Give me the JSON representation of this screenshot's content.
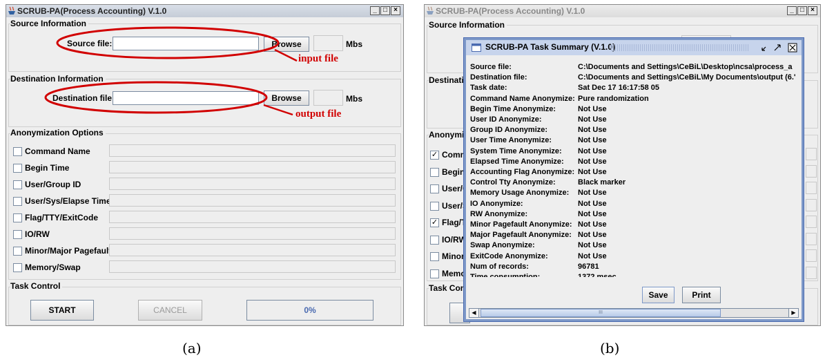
{
  "captions": {
    "a": "(a)",
    "b": "(b)"
  },
  "window_a": {
    "title": "SCRUB-PA(Process Accounting) V.1.0",
    "controls": {
      "minimize": "_",
      "maximize": "□",
      "close": "×"
    },
    "source_section": {
      "label": "Source Information",
      "field_label": "Source file:",
      "field_value": "",
      "browse_label": "Browse",
      "size_value": "",
      "unit": "Mbs"
    },
    "destination_section": {
      "label": "Destination Information",
      "field_label": "Destination file:",
      "field_value": "",
      "browse_label": "Browse",
      "size_value": "",
      "unit": "Mbs"
    },
    "anonymization_section": {
      "label": "Anonymization Options",
      "options": [
        {
          "label": "Command Name",
          "checked": false
        },
        {
          "label": "Begin Time",
          "checked": false
        },
        {
          "label": "User/Group ID",
          "checked": false
        },
        {
          "label": "User/Sys/Elapse Time",
          "checked": false
        },
        {
          "label": "Flag/TTY/ExitCode",
          "checked": false
        },
        {
          "label": "IO/RW",
          "checked": false
        },
        {
          "label": "Minor/Major Pagefault",
          "checked": false
        },
        {
          "label": "Memory/Swap",
          "checked": false
        }
      ]
    },
    "task_section": {
      "label": "Task Control",
      "start_label": "START",
      "cancel_label": "CANCEL",
      "progress_text": "0%",
      "progress_value": 0
    },
    "annotations": {
      "input": "input file",
      "output": "output file"
    },
    "annotation_color": "#d10000"
  },
  "window_b": {
    "title": "SCRUB-PA(Process Accounting) V.1.0",
    "controls": {
      "minimize": "_",
      "maximize": "□",
      "close": "×"
    },
    "section_labels": {
      "source": "Source Information",
      "destination": "Destinatio",
      "anonymization": "Anonymiz",
      "task": "Task Con"
    },
    "options": [
      {
        "label": "Comm",
        "checked": true
      },
      {
        "label": "Begin",
        "checked": false
      },
      {
        "label": "User/G",
        "checked": false
      },
      {
        "label": "User/S",
        "checked": false
      },
      {
        "label": "Flag/T",
        "checked": true
      },
      {
        "label": "IO/RW",
        "checked": false
      },
      {
        "label": "Minor/",
        "checked": false
      },
      {
        "label": "Memo",
        "checked": false
      }
    ],
    "dialog": {
      "title": "SCRUB-PA Task Summary (V.1.0)",
      "rows": [
        {
          "key": "Source file:",
          "value": "C:\\Documents and Settings\\CeBiL\\Desktop\\ncsa\\process_a"
        },
        {
          "key": "Destination file:",
          "value": "C:\\Documents and Settings\\CeBiL\\My Documents\\output (6.'"
        },
        {
          "key": "Task date:",
          "value": "Sat Dec 17  16:17:58 05"
        },
        {
          "key": "Command Name Anonymize:",
          "value": "Pure randomization"
        },
        {
          "key": "Begin Time Anonymize:",
          "value": "Not Use"
        },
        {
          "key": "User ID Anonymize:",
          "value": "Not Use"
        },
        {
          "key": "Group ID Anonymize:",
          "value": "Not Use"
        },
        {
          "key": "User Time Anonymize:",
          "value": "Not Use"
        },
        {
          "key": "System Time Anonymize:",
          "value": "Not Use"
        },
        {
          "key": "Elapsed Time Anonymize:",
          "value": "Not Use"
        },
        {
          "key": "Accounting Flag Anonymize:",
          "value": "Not Use"
        },
        {
          "key": "Control Tty Anonymize:",
          "value": "Black marker"
        },
        {
          "key": "Memory Usage Anonymize:",
          "value": "Not Use"
        },
        {
          "key": "IO Anonymize:",
          "value": "Not Use"
        },
        {
          "key": "RW Anonymize:",
          "value": "Not Use"
        },
        {
          "key": "Minor Pagefault Anonymize:",
          "value": "Not Use"
        },
        {
          "key": "Major Pagefault Anonymize:",
          "value": "Not Use"
        },
        {
          "key": "Swap Anonymize:",
          "value": "Not Use"
        },
        {
          "key": "ExitCode Anonymize:",
          "value": "Not Use"
        },
        {
          "key": "Num of records:",
          "value": "96781"
        },
        {
          "key": "Time consumption:",
          "value": "1372 msec"
        }
      ],
      "save_label": "Save",
      "print_label": "Print",
      "scroll_left": "◀",
      "scroll_right": "▶",
      "scroll_grip": "III"
    }
  }
}
